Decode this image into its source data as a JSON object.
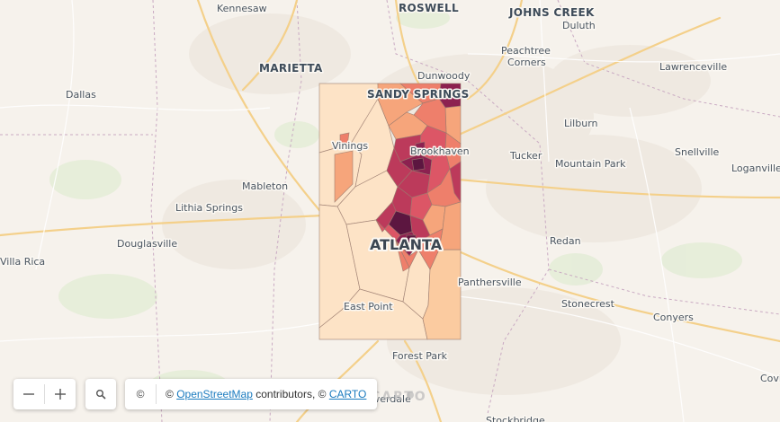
{
  "map": {
    "labels": {
      "kennesaw": "Kennesaw",
      "roswell": "ROSWELL",
      "johns_creek": "JOHNS CREEK",
      "duluth": "Duluth",
      "dallas": "Dallas",
      "marietta": "MARIETTA",
      "dunwoody": "Dunwoody",
      "peachtree_corners_1": "Peachtree",
      "peachtree_corners_2": "Corners",
      "lawrenceville": "Lawrenceville",
      "sandy_springs": "SANDY SPRINGS",
      "lilburn": "Lilburn",
      "vinings": "Vinings",
      "brookhaven": "Brookhaven",
      "tucker": "Tucker",
      "snellville": "Snellville",
      "mountain_park": "Mountain Park",
      "mableton": "Mableton",
      "loganville": "Loganville",
      "lithia_springs": "Lithia Springs",
      "douglasville": "Douglasville",
      "atlanta": "ATLANTA",
      "redan": "Redan",
      "villa_rica": "Villa Rica",
      "panthersville": "Panthersville",
      "stonecrest": "Stonecrest",
      "east_point": "East Point",
      "conyers": "Conyers",
      "forest_park": "Forest Park",
      "riverdale": "Riverdale",
      "stockbridge": "Stockbridge",
      "covington": "Covi"
    },
    "choropleth_colors": [
      "#fde3c6",
      "#fbcba0",
      "#f6a57b",
      "#ee7f6b",
      "#dc5666",
      "#bc3a5b",
      "#8c2150",
      "#5c1640"
    ]
  },
  "controls": {
    "zoom_out_icon": "minus-icon",
    "zoom_in_icon": "plus-icon",
    "search_icon": "search-icon",
    "info_symbol": "©"
  },
  "attribution": {
    "prefix": "©",
    "osm_link": "OpenStreetMap",
    "middle": "contributors, ©",
    "carto_link": "CARTO"
  },
  "watermark": "CARTO"
}
